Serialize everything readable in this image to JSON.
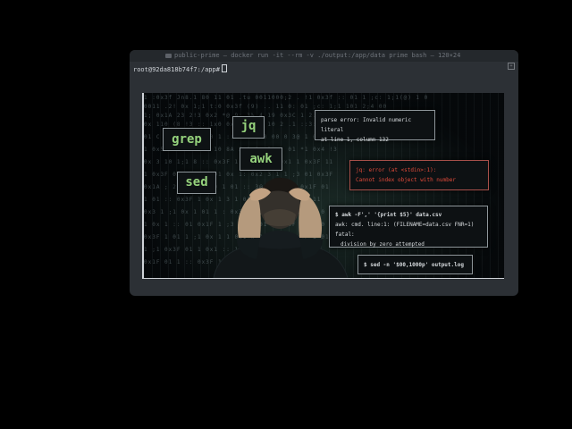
{
  "window": {
    "title": "public-prime — docker run -it --rm -v ./output:/app/data prime bash — 120×24",
    "expand_icon": "expand-icon"
  },
  "terminal": {
    "prompt": "root@92da818b74f7:/app#"
  },
  "illustration": {
    "background_lines": [
      "1 :0x3f  Jn8.1 80  11 01 .tu  0011000;2 . !1  0x3f :: 01 1  ;c: 1;1(@) 1 0",
      "0011 .2!  0x  1;1  t:0 0x3f  (9)  .. 11 0: 01  ;c: 1;1 101 2;4 00",
      "1; 0x1A 23  2!3 0x2  *@ 9: 3% 4 19 0x3C  1 2.001 0x3f ^0 1%",
      "0x 110 (8 !3 ::  1x0 0x2E  01 r 10 2 .1 ::3: ;2  0x1f 0A",
      "01 C x4 0x3  9 1;0 1 :: 0x.b  10 00 0 3@ 1 0x3F  01 1",
      "1  0x5 !3 0x1  ::1 10 8A  2 1 0x  1 .. 01 *1 0x4 !3",
      "0x 3 10  1;1 8  ::  0x3F 1 0 01 0 2 0x1 1 0x3F 11",
      "1 0x3F  01 1 1 ..  01 0x 1: 0x2 3 1 1 ;3  01 0x3F",
      "0x1A ;  21 1 0x3f  0 1 01 :: 3@ 0x 10 1  0x1F 01",
      "1 01 ::  0x3F 1  0x 1 3 1 01 ..  0x3F  1 0x1 11",
      "0x3 1 ;1 0x  1 01 1 : 0x3F 1 ; 01 1 0x1  3 1 0",
      "1 0x  1 :: 01 0x1F 1 ;3 1 0x 01  1 0x3F 1 :: 0",
      "0x3F 1 01 1 ;1 0x 1 1 0x1 3 01 :: 1 0x3F 1 01",
      "1 ;1  0x3F 01 1 0x1  ::  1 0x 3 1 0x3F 01 1 1",
      "0x1F 01 1 ::  0x3F 1 0x 1 01 ;1 1 0x3F 01 1"
    ],
    "tags": {
      "grep": "grep",
      "jq": "jq",
      "awk": "awk",
      "sed": "sed"
    },
    "errors": {
      "parse_line1": "parse error: Invalid numeric literal",
      "parse_line2": "at line 1, column 132",
      "jq_line1": "jq: error (at <stdin>:1):",
      "jq_line2": "Cannot index object with number",
      "awk_cmd": "$ awk -F',' '{print $5}' data.csv",
      "awk_line1": "awk: cmd. line:1: (FILENAME=data.csv FNR=1) fatal:",
      "awk_line2": "division by zero attempted",
      "sed_cmd": "$ sed -n '$00,1000p' output.log"
    }
  },
  "colors": {
    "page_background": "#000000",
    "terminal_background": "#2c3035",
    "tag_green": "#95d27c",
    "error_red": "#e14a3a"
  }
}
